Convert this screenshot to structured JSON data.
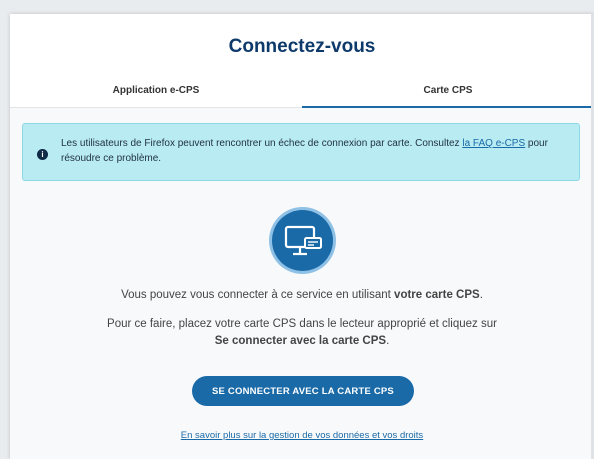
{
  "header": {
    "title": "Connectez-vous"
  },
  "tabs": [
    {
      "label": "Application e-CPS",
      "active": false
    },
    {
      "label": "Carte CPS",
      "active": true
    }
  ],
  "alert": {
    "text_before": "Les utilisateurs de Firefox peuvent rencontrer un échec de connexion par carte. Consultez ",
    "link": "la FAQ e-CPS",
    "text_after": " pour résoudre ce problème.",
    "icon": "info-icon",
    "color": "#b8ebf2"
  },
  "main": {
    "illustration_icon": "computer-card-reader-icon",
    "desc1_before": "Vous pouvez vous connecter à ce service en utilisant ",
    "desc1_bold": "votre carte CPS",
    "desc1_after": ".",
    "desc2_before": "Pour ce faire, placez votre carte CPS dans le lecteur approprié et cliquez sur ",
    "desc2_bold": "Se connecter avec la carte CPS",
    "desc2_after": ".",
    "button_label": "SE CONNECTER AVEC LA CARTE CPS",
    "more_link": "En savoir plus sur la gestion de vos données et vos droits"
  },
  "colors": {
    "primary": "#1a6aa8",
    "title": "#0e3a6b"
  }
}
